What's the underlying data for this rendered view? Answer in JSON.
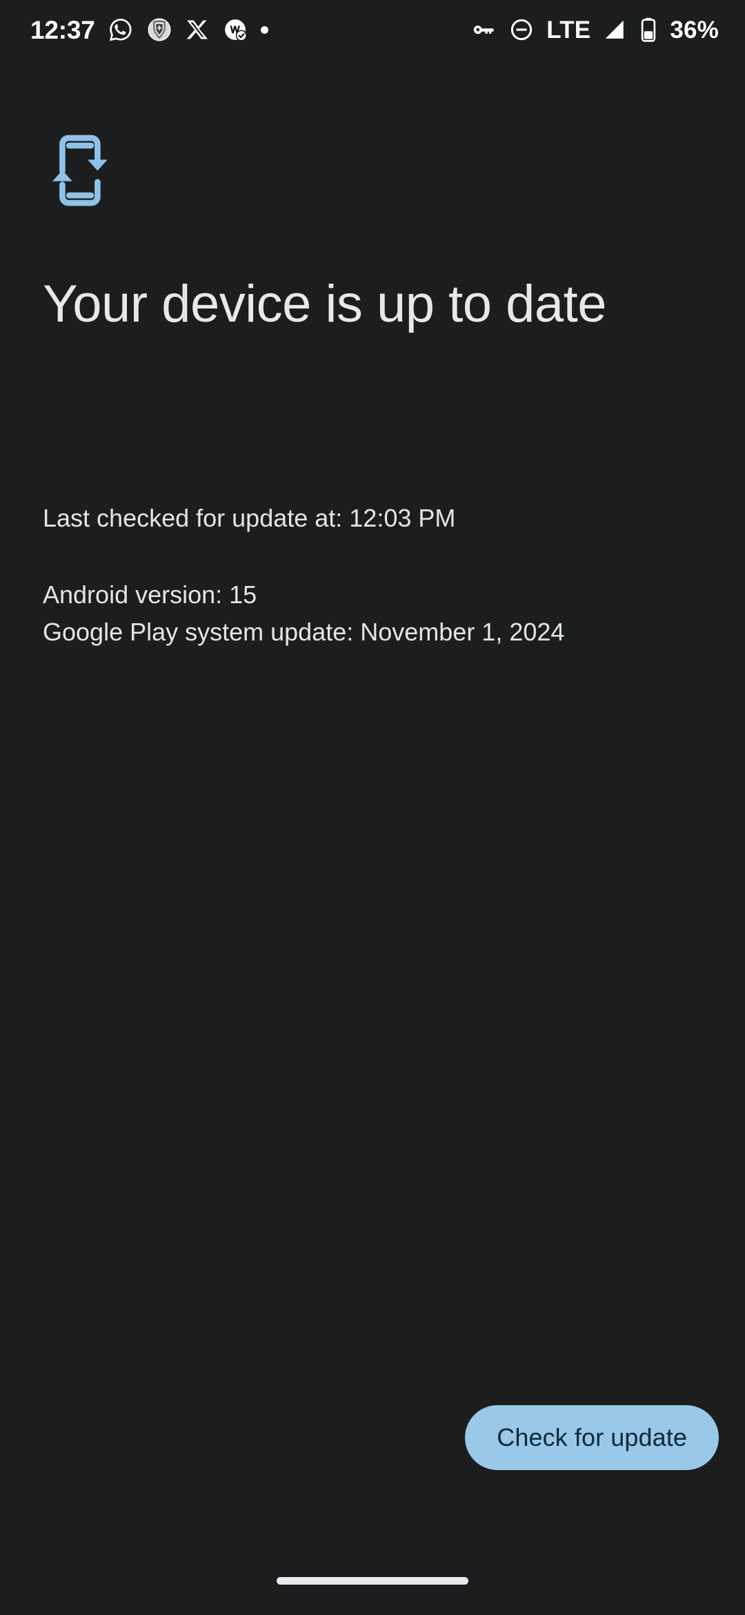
{
  "statusbar": {
    "clock": "12:37",
    "left_icons": [
      {
        "name": "whatsapp-icon",
        "label": "WhatsApp"
      },
      {
        "name": "manchester-united-icon",
        "label": "Manchester United"
      },
      {
        "name": "x-twitter-icon",
        "label": "X"
      },
      {
        "name": "app-badge-check-icon",
        "label": "App notification"
      },
      {
        "name": "more-notifications-dot-icon",
        "label": "More"
      }
    ],
    "right_icons": [
      {
        "name": "vpn-key-icon",
        "label": "VPN"
      },
      {
        "name": "do-not-disturb-icon",
        "label": "Do not disturb"
      }
    ],
    "network_label": "LTE",
    "battery_percent": "36%"
  },
  "main": {
    "icon_name": "system-update-icon",
    "headline": "Your device is up to date",
    "last_checked": "Last checked for update at: 12:03 PM",
    "android_version": "Android version: 15",
    "play_system_update": "Google Play system update: November 1, 2024"
  },
  "actions": {
    "check_for_update": "Check for update"
  },
  "colors": {
    "background": "#1b1d1f",
    "accent": "#9ac8e8",
    "button_text": "#0d2a3d",
    "text_primary": "#e6e8e9"
  }
}
